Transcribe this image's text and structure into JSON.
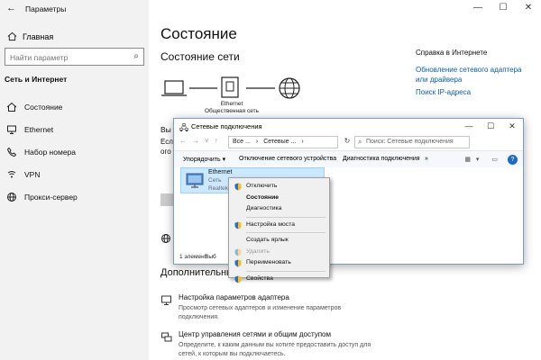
{
  "window": {
    "title": "Параметры",
    "controls": [
      "—",
      "☐",
      "✕"
    ]
  },
  "sidebar": {
    "home": "Главная",
    "search_placeholder": "Найти параметр",
    "section": "Сеть и Интернет",
    "items": [
      {
        "label": "Состояние",
        "icon": "home-icon"
      },
      {
        "label": "Ethernet",
        "icon": "monitor-icon"
      },
      {
        "label": "Набор номера",
        "icon": "phone-icon"
      },
      {
        "label": "VPN",
        "icon": "vpn-icon"
      },
      {
        "label": "Прокси-сервер",
        "icon": "globe-icon"
      }
    ]
  },
  "main": {
    "title": "Состояние",
    "network_status": "Состояние сети",
    "eth_label": "Ethernet",
    "eth_sub": "Общественная сеть",
    "partial_lines": [
      "Вы",
      "Есл",
      "ого"
    ],
    "extra_title": "Дополнительны",
    "options": [
      {
        "title": "Настройка параметров адаптера",
        "desc": "Просмотр сетевых адаптеров и изменение параметров подключения."
      },
      {
        "title": "Центр управления сетями и общим доступом",
        "desc": "Определите, к каким данным вы хотите предоставить доступ для сетей, к которым вы подключаетесь."
      }
    ]
  },
  "help": {
    "title": "Справка в Интернете",
    "links": [
      "Обновление сетевого адаптера или драйвера",
      "Поиск IP-адреса"
    ]
  },
  "netconn": {
    "title": "Сетевые подключения",
    "controls": [
      "—",
      "☐",
      "✕"
    ],
    "path": [
      "Все ...",
      "Сетевые ..."
    ],
    "search_placeholder": "Поиск: Сетевые подключения",
    "toolbar": [
      "Упорядочить ▾",
      "Отключение сетевого устройства",
      "Диагностика подключения",
      "»"
    ],
    "item": {
      "name": "Ethernet",
      "line1": "Сеть",
      "line2": "Realtek P"
    },
    "status": "1 элемент",
    "status2": "Выб"
  },
  "context_menu": {
    "items": [
      {
        "label": "Отключить",
        "icon": "shield-icon",
        "style": "normal"
      },
      {
        "label": "Состояние",
        "icon": "",
        "style": "bold"
      },
      {
        "label": "Диагностика",
        "icon": "",
        "style": "normal"
      },
      {
        "sep": true
      },
      {
        "label": "Настройка моста",
        "icon": "shield-icon",
        "style": "normal"
      },
      {
        "sep": true
      },
      {
        "label": "Создать ярлык",
        "icon": "",
        "style": "normal"
      },
      {
        "label": "Удалить",
        "icon": "shield-icon",
        "style": "disabled"
      },
      {
        "label": "Переименовать",
        "icon": "shield-icon",
        "style": "normal"
      },
      {
        "sep": true
      },
      {
        "label": "Свойства",
        "icon": "shield-icon",
        "style": "normal"
      }
    ]
  },
  "colors": {
    "accent": "#0a5fb4",
    "selection": "#cce8ff"
  }
}
